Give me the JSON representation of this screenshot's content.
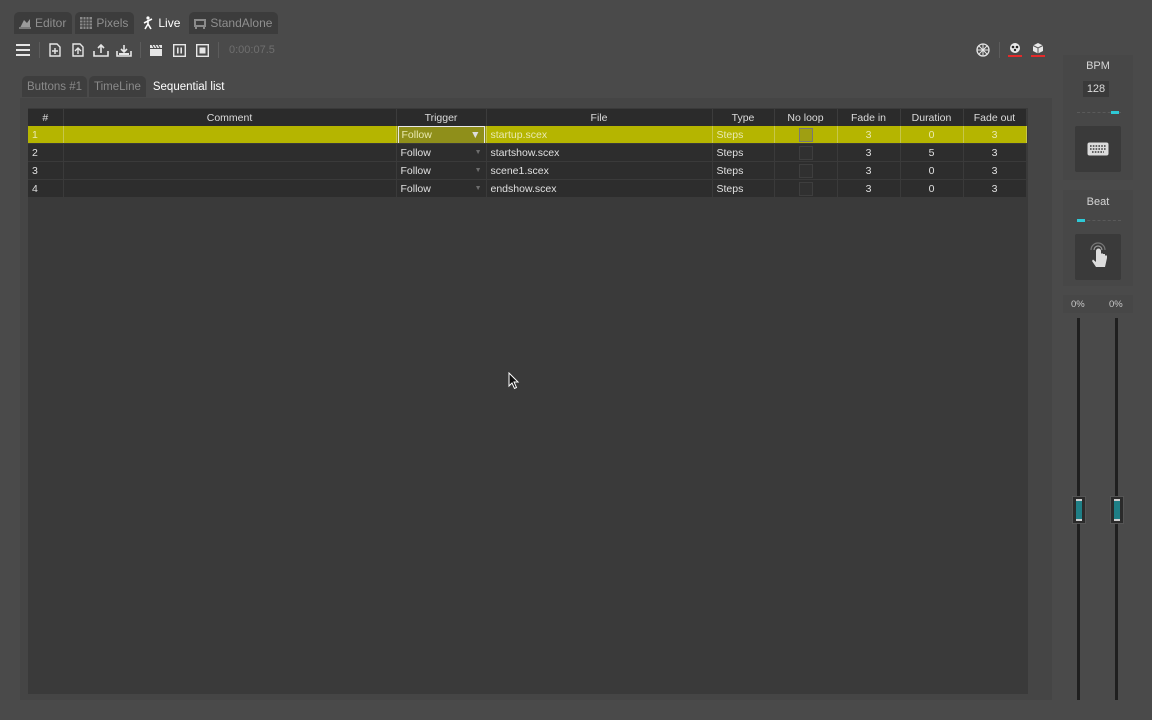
{
  "top_tabs": [
    {
      "label": "Editor",
      "icon": "editor-icon",
      "active": false
    },
    {
      "label": "Pixels",
      "icon": "pixels-icon",
      "active": false
    },
    {
      "label": "Live",
      "icon": "live-icon",
      "active": true
    },
    {
      "label": "StandAlone",
      "icon": "standalone-icon",
      "active": false
    }
  ],
  "toolbar": {
    "icons": [
      "menu-icon",
      "new-file-icon",
      "open-file-icon",
      "export-icon",
      "import-icon",
      "clapper-icon",
      "pause-icon",
      "stop-icon"
    ],
    "timer": "0:00:07.5",
    "right_icons": [
      "network-icon",
      "device-red-icon",
      "device-cube-icon"
    ]
  },
  "sub_tabs": [
    {
      "label": "Buttons #1",
      "active": false
    },
    {
      "label": "TimeLine",
      "active": false
    },
    {
      "label": "Sequential list",
      "active": true
    }
  ],
  "table": {
    "headers": [
      "#",
      "Comment",
      "Trigger",
      "File",
      "Type",
      "No loop",
      "Fade in",
      "Duration",
      "Fade out"
    ],
    "rows": [
      {
        "num": "1",
        "comment": "",
        "trigger": "Follow",
        "file": "startup.scex",
        "type": "Steps",
        "no_loop": false,
        "fade_in": "3",
        "duration": "0",
        "fade_out": "3",
        "selected": true
      },
      {
        "num": "2",
        "comment": "",
        "trigger": "Follow",
        "file": "startshow.scex",
        "type": "Steps",
        "no_loop": false,
        "fade_in": "3",
        "duration": "5",
        "fade_out": "3",
        "selected": false
      },
      {
        "num": "3",
        "comment": "",
        "trigger": "Follow",
        "file": "scene1.scex",
        "type": "Steps",
        "no_loop": false,
        "fade_in": "3",
        "duration": "0",
        "fade_out": "3",
        "selected": false
      },
      {
        "num": "4",
        "comment": "",
        "trigger": "Follow",
        "file": "endshow.scex",
        "type": "Steps",
        "no_loop": false,
        "fade_in": "3",
        "duration": "0",
        "fade_out": "3",
        "selected": false
      }
    ]
  },
  "side": {
    "bpm_label": "BPM",
    "bpm_value": "128",
    "beat_label": "Beat",
    "fader_left_pct": "0%",
    "fader_right_pct": "0%"
  },
  "colors": {
    "selected_row": "#b5b500",
    "accent_led": "#2ec9d6",
    "background": "#4a4a4a"
  }
}
